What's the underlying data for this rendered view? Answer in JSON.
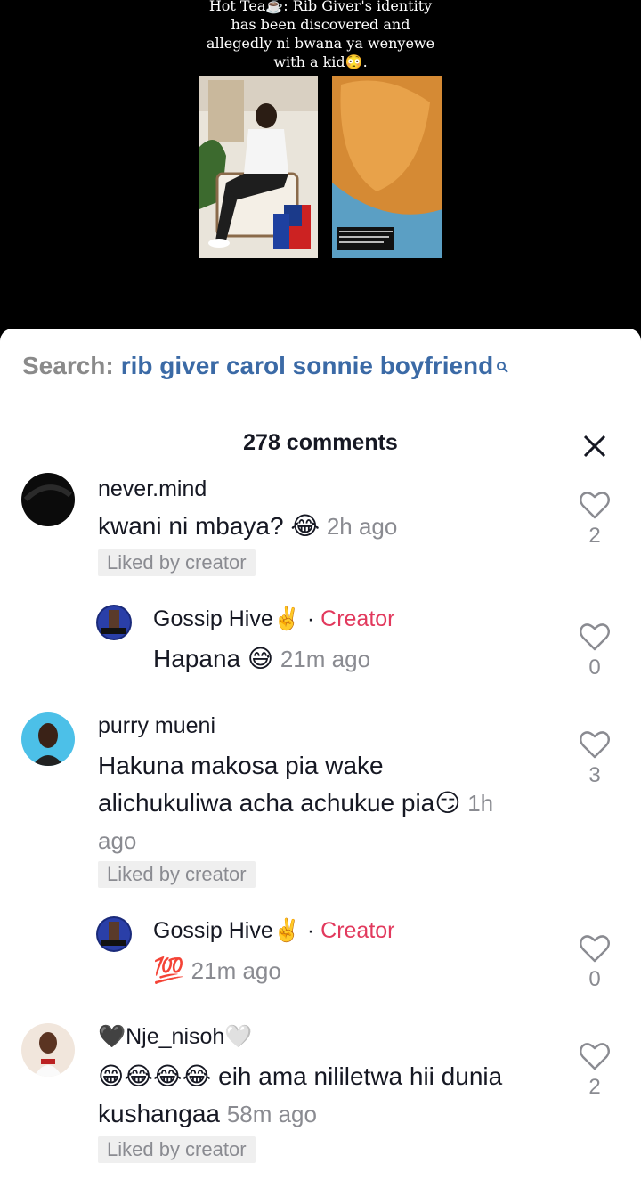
{
  "video": {
    "caption_line1": "Hot Tea☕: Rib Giver's identity",
    "caption_line2": "has been discovered and",
    "caption_line3": "allegedly ni bwana ya wenyewe",
    "caption_line4": "with a kid😳."
  },
  "search": {
    "prefix": "Search:",
    "query": "rib giver carol sonnie boyfriend"
  },
  "comments_header": {
    "count_label": "278 comments"
  },
  "comments": [
    {
      "username": "never.mind",
      "text": "kwani ni mbaya? 😂",
      "time": "2h ago",
      "liked_label": "Liked by creator",
      "likes": "2"
    },
    {
      "username": "Gossip Hive✌️",
      "creator_label": "Creator",
      "text": "Hapana 😅",
      "time": "21m ago",
      "likes": "0"
    },
    {
      "username": "purry mueni",
      "text_line1": "Hakuna makosa pia wake",
      "text_line2": "alichukuliwa acha achukue pia😏",
      "time_part1": "1h",
      "time_part2": "ago",
      "liked_label": "Liked by creator",
      "likes": "3"
    },
    {
      "username": "Gossip Hive✌️",
      "creator_label": "Creator",
      "text": "💯",
      "time": "21m ago",
      "likes": "0"
    },
    {
      "username": "🖤Nje_nisoh🤍",
      "text_line1": "😁😂😂😂 eih ama nililetwa hii dunia",
      "text_line2": "kushangaa",
      "time": "58m ago",
      "liked_label": "Liked by creator",
      "likes": "2"
    }
  ],
  "colors": {
    "creator": "#e2395d",
    "search_query": "#3b6aa6",
    "muted": "#8a8b91"
  }
}
